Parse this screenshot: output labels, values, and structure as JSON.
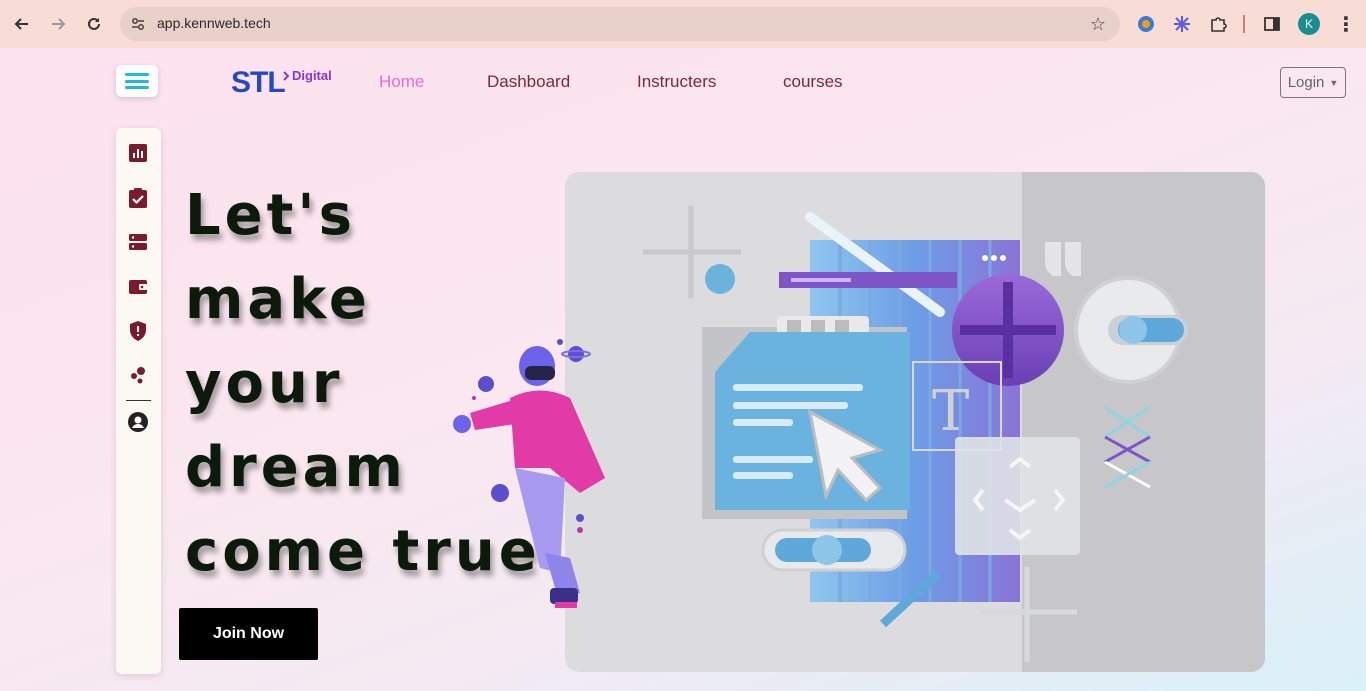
{
  "browser": {
    "url": "app.kennweb.tech",
    "profile_initial": "K",
    "icons": [
      "back-arrow-icon",
      "forward-arrow-icon",
      "reload-icon",
      "site-settings-icon",
      "bookmark-star-icon",
      "extension-icon",
      "extension-icon",
      "puzzle-icon",
      "side-panel-icon",
      "menu-kebab-icon"
    ]
  },
  "header": {
    "logo_main": "STL",
    "logo_sub": "Digital",
    "nav": [
      {
        "label": "Home",
        "active": true
      },
      {
        "label": "Dashboard",
        "active": false
      },
      {
        "label": "Instructers",
        "active": false
      },
      {
        "label": "courses",
        "active": false
      }
    ],
    "login_label": "Login"
  },
  "sidebar": {
    "items": [
      {
        "icon": "bar-chart-icon"
      },
      {
        "icon": "clipboard-check-icon"
      },
      {
        "icon": "server-icon"
      },
      {
        "icon": "wallet-icon"
      },
      {
        "icon": "shield-alert-icon"
      },
      {
        "icon": "bubbles-icon"
      },
      {
        "icon": "user-circle-icon"
      }
    ]
  },
  "hero": {
    "lines": [
      "Let's",
      "make",
      "your",
      "dream",
      "come true"
    ],
    "cta_label": "Join Now"
  },
  "colors": {
    "accent_nav_active": "#ee66d8",
    "nav_text": "#7a2a34",
    "sidebar_icon": "#7a1a2c",
    "logo_blue": "#2548c9",
    "logo_purple": "#8a35d8",
    "menu_bars": "#1fb6e8"
  }
}
